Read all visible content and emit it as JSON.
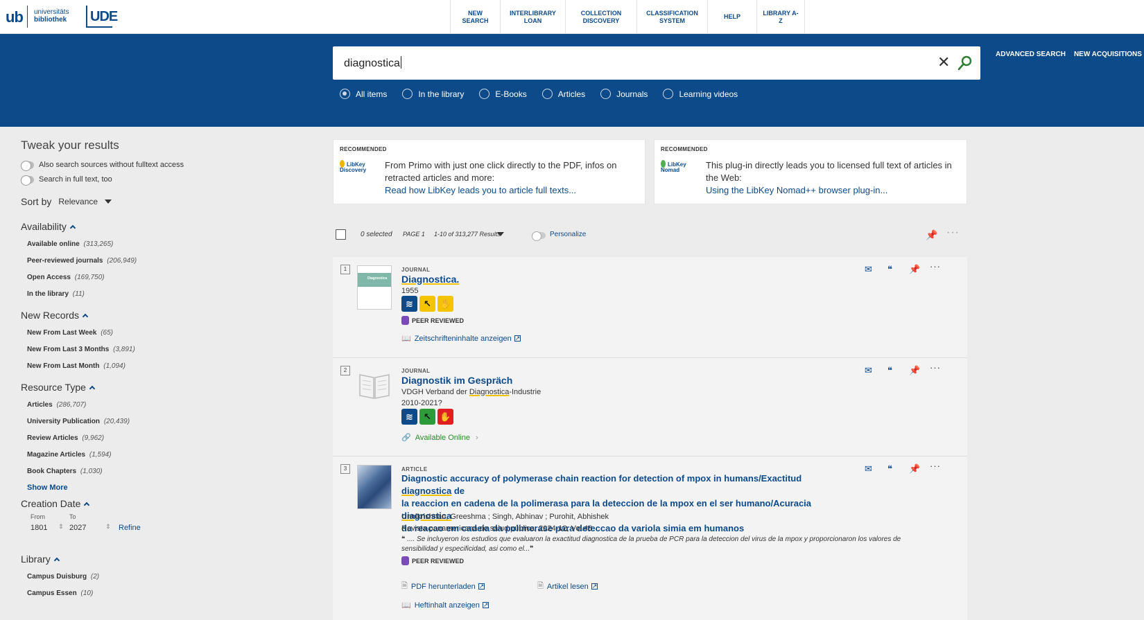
{
  "header": {
    "logo_ub": "ub",
    "logo_ub_line1": "universitäts",
    "logo_ub_line2": "bibliothek",
    "logo_ude": "UDE",
    "nav": [
      {
        "label": "NEW SEARCH"
      },
      {
        "label": "INTERLIBRARY LOAN"
      },
      {
        "label": "COLLECTION DISCOVERY"
      },
      {
        "label": "CLASSIFICATION SYSTEM"
      },
      {
        "label": "HELP"
      },
      {
        "label": "LIBRARY A-Z"
      }
    ]
  },
  "search": {
    "query": "diagnostica",
    "clear_glyph": "✕",
    "scopes": [
      {
        "label": "All items",
        "selected": true
      },
      {
        "label": "In the library",
        "selected": false
      },
      {
        "label": "E-Books",
        "selected": false
      },
      {
        "label": "Articles",
        "selected": false
      },
      {
        "label": "Journals",
        "selected": false
      },
      {
        "label": "Learning videos",
        "selected": false
      }
    ],
    "advanced": "ADVANCED SEARCH",
    "new_acquisitions": "NEW ACQUISITIONS"
  },
  "sidebar": {
    "title": "Tweak your results",
    "toggle1": "Also search sources without fulltext access",
    "toggle2": "Search in full text, too",
    "sort_label": "Sort by",
    "sort_value": "Relevance",
    "facets": [
      {
        "title": "Availability",
        "items": [
          {
            "label": "Available online",
            "count": "(313,265)"
          },
          {
            "label": "Peer-reviewed journals",
            "count": "(206,949)"
          },
          {
            "label": "Open Access",
            "count": "(169,750)"
          },
          {
            "label": "In the library",
            "count": "(11)"
          }
        ]
      },
      {
        "title": "New Records",
        "items": [
          {
            "label": "New From Last Week",
            "count": "(65)"
          },
          {
            "label": "New From Last 3 Months",
            "count": "(3,891)"
          },
          {
            "label": "New From Last Month",
            "count": "(1,094)"
          }
        ]
      },
      {
        "title": "Resource Type",
        "items": [
          {
            "label": "Articles",
            "count": "(286,707)"
          },
          {
            "label": "University Publication",
            "count": "(20,439)"
          },
          {
            "label": "Review Articles",
            "count": "(9,962)"
          },
          {
            "label": "Magazine Articles",
            "count": "(1,594)"
          },
          {
            "label": "Book Chapters",
            "count": "(1,030)"
          }
        ]
      }
    ],
    "show_more": "Show More",
    "creation_date": {
      "title": "Creation Date",
      "from_label": "From",
      "to_label": "To",
      "from": "1801",
      "to": "2027",
      "refine": "Refine"
    },
    "library": {
      "title": "Library",
      "items": [
        {
          "label": "Campus Duisburg",
          "count": "(2)"
        },
        {
          "label": "Campus Essen",
          "count": "(10)"
        }
      ]
    }
  },
  "recommended": [
    {
      "heading": "RECOMMENDED",
      "badge": "LibKey Discovery",
      "drop_color": "#f0b400",
      "text": "From Primo with just one click directly to the PDF, infos on retracted articles and more:",
      "link": "Read how LibKey leads you to article full texts..."
    },
    {
      "heading": "RECOMMENDED",
      "badge": "LibKey Nomad",
      "drop_color": "#4caf50",
      "text": "This plug-in directly leads you to licensed full text of articles in the Web:",
      "link": "Using the LibKey Nomad++ browser plug-in..."
    }
  ],
  "toolbar": {
    "selected": "0 selected",
    "page": "PAGE 1",
    "results": "1-10 of 313,277 Results",
    "personalize": "Personalize"
  },
  "results": [
    {
      "num": "1",
      "type": "JOURNAL",
      "title": "Diagnostica.",
      "year": "1955",
      "cover_text": "Diagnostica",
      "peer": "PEER REVIEWED",
      "link": "Zeitschrifteninhalte anzeigen"
    },
    {
      "num": "2",
      "type": "JOURNAL",
      "title": "Diagnostik im Gespräch",
      "publisher_pre": "VDGH Verband der ",
      "publisher_mark": "Diagnostica",
      "publisher_post": "-Industrie",
      "years": "2010-2021?",
      "avail": "Available Online"
    },
    {
      "num": "3",
      "type": "ARTICLE",
      "title_1": "Diagnostic accuracy of polymerase chain reaction for detection of mpox in humans/Exactitud ",
      "title_m1": "diagnostica",
      "title_2": " de",
      "title_3": "la reaccion en cadena de la polimerasa para la deteccion de la mpox en el ser humano/Acuracia ",
      "title_m2": "diagnostica",
      "title_4": "da reacao em cadeia da polimerase para deteccao da variola simia em humanos",
      "authors": "Unnikrishnan, Greeshma ; Singh, Abhinav ; Purohit, Abhishek",
      "source": "Revista panamericana de salud pública, 2024-12, Vol.48",
      "snippet": "❝ .... Se incluyeron los estudios que evaluaron la exactitud diagnostica de la prueba de PCR para la deteccion del virus de la mpox y proporcionaron los valores de sensibilidad y especificidad, asi como el...❞",
      "peer": "PEER REVIEWED",
      "link_pdf": "PDF herunterladen",
      "link_read": "Artikel lesen",
      "link_toc": "Heftinhalt anzeigen"
    }
  ]
}
